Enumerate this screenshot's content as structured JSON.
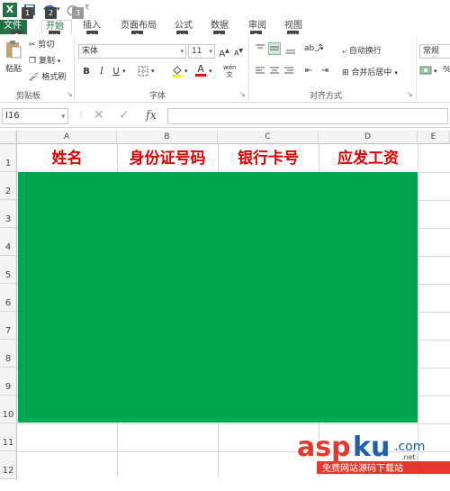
{
  "titlebar": {
    "qat_keytips": [
      "1",
      "2",
      "3"
    ]
  },
  "tabs": [
    {
      "label": "文件",
      "keytip": "F"
    },
    {
      "label": "开始",
      "keytip": "H"
    },
    {
      "label": "插入",
      "keytip": "N"
    },
    {
      "label": "页面布局",
      "keytip": "P"
    },
    {
      "label": "公式",
      "keytip": "M"
    },
    {
      "label": "数据",
      "keytip": "A"
    },
    {
      "label": "审阅",
      "keytip": "R"
    },
    {
      "label": "视图",
      "keytip": "W"
    }
  ],
  "clipboard": {
    "paste": "粘贴",
    "cut": "剪切",
    "copy": "复制",
    "format_painter": "格式刷",
    "group_label": "剪贴板"
  },
  "font": {
    "font_name": "宋体",
    "font_size": "11",
    "bold": "B",
    "italic": "I",
    "underline": "U",
    "group_label": "字体"
  },
  "alignment": {
    "wrap_text": "自动换行",
    "merge_center": "合并后居中",
    "group_label": "对齐方式"
  },
  "number": {
    "format": "常规"
  },
  "formula_bar": {
    "name_box": "I16",
    "fx": "fx",
    "formula": ""
  },
  "columns": [
    "A",
    "B",
    "C",
    "D",
    "E"
  ],
  "rows": [
    "1",
    "2",
    "3",
    "4",
    "5",
    "6",
    "7",
    "8",
    "9",
    "10",
    "11",
    "12"
  ],
  "cells": {
    "A1": "姓名",
    "B1": "身份证号码",
    "C1": "银行卡号",
    "D1": "应发工资"
  },
  "colors": {
    "excel_green": "#217346",
    "fill_green": "#00a651",
    "header_red": "#e00000"
  },
  "watermark": {
    "logo": "aspku.com",
    "sub": "免费网站源码下载站"
  }
}
